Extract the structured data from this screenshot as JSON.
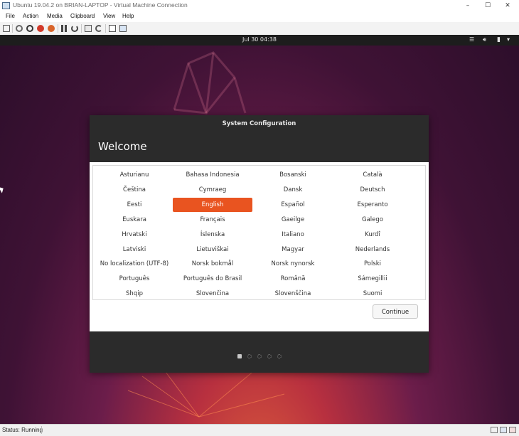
{
  "window": {
    "title": "Ubuntu 19.04.2 on BRIAN-LAPTOP - Virtual Machine Connection",
    "minimize": "–",
    "maximize": "☐",
    "close": "✕"
  },
  "menu": {
    "items": [
      "File",
      "Action",
      "Media",
      "Clipboard",
      "View",
      "Help"
    ]
  },
  "toolbar": {
    "icons": [
      "ctrl-alt-del-icon",
      "start-icon",
      "turn-off-icon",
      "shut-down-icon",
      "save-icon",
      "pause-icon",
      "reset-icon",
      "checkpoint-icon",
      "revert-icon",
      "enhanced-session-icon"
    ]
  },
  "topbar": {
    "clock": "Jul 30  04:38",
    "icons": [
      "network-icon",
      "volume-icon",
      "battery-icon",
      "menu-arrow-icon"
    ]
  },
  "dialog": {
    "title": "System Configuration",
    "heading": "Welcome",
    "languages": [
      [
        "Asturianu",
        "Bahasa Indonesia",
        "Bosanski",
        "Català"
      ],
      [
        "Čeština",
        "Cymraeg",
        "Dansk",
        "Deutsch"
      ],
      [
        "Eesti",
        "English",
        "Español",
        "Esperanto"
      ],
      [
        "Euskara",
        "Français",
        "Gaeilge",
        "Galego"
      ],
      [
        "Hrvatski",
        "Íslenska",
        "Italiano",
        "Kurdî"
      ],
      [
        "Latviski",
        "Lietuviškai",
        "Magyar",
        "Nederlands"
      ],
      [
        "No localization (UTF-8)",
        "Norsk bokmål",
        "Norsk nynorsk",
        "Polski"
      ],
      [
        "Português",
        "Português do Brasil",
        "Română",
        "Sámegillii"
      ],
      [
        "Shqip",
        "Slovenčina",
        "Slovenščina",
        "Suomi"
      ]
    ],
    "selected_language": "English",
    "continue_label": "Continue",
    "page_step": 1,
    "page_total": 5
  },
  "status": {
    "text": "Status: Running"
  },
  "colors": {
    "accent": "#e95420",
    "dialog_bg": "#2b2b2b",
    "topbar_bg": "#1d1d1d"
  }
}
